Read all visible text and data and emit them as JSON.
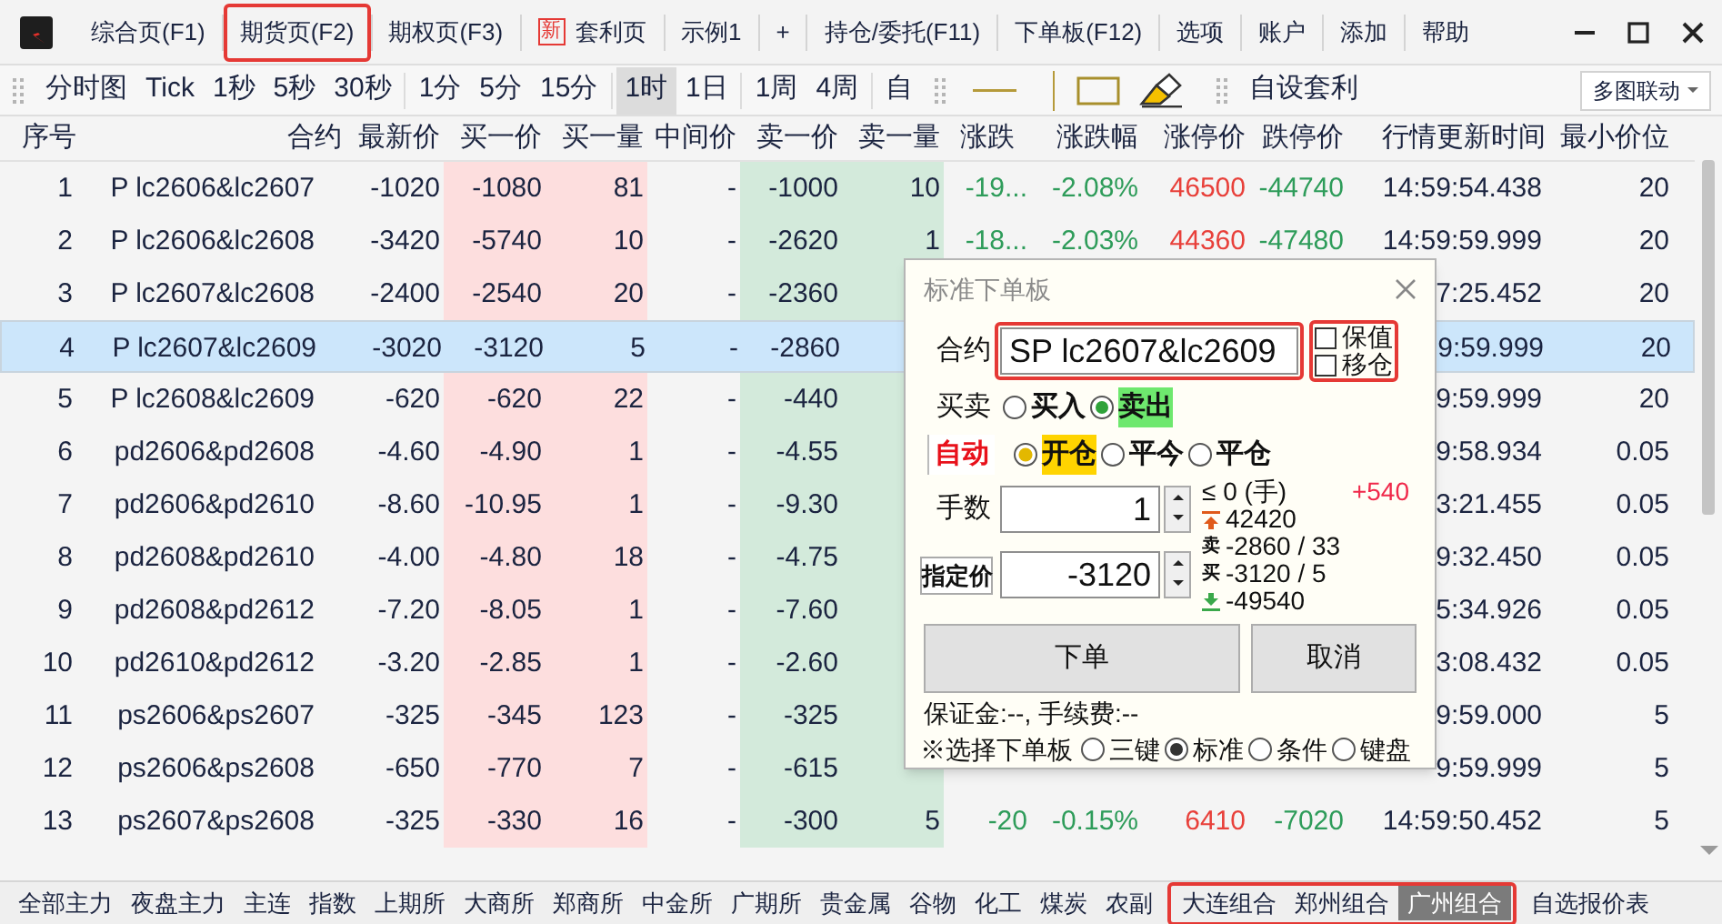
{
  "tabs": [
    {
      "label": "综合页(F1)",
      "highlighted": false
    },
    {
      "label": "期货页(F2)",
      "highlighted": true
    },
    {
      "label": "期权页(F3)",
      "highlighted": false
    },
    {
      "label": "套利页",
      "badge": "新",
      "highlighted": false
    },
    {
      "label": "示例1",
      "highlighted": false
    },
    {
      "label": "+",
      "highlighted": false
    },
    {
      "label": "持仓/委托(F11)",
      "highlighted": false
    },
    {
      "label": "下单板(F12)",
      "highlighted": false
    },
    {
      "label": "选项",
      "highlighted": false
    },
    {
      "label": "账户",
      "highlighted": false
    },
    {
      "label": "添加",
      "highlighted": false
    },
    {
      "label": "帮助",
      "highlighted": false
    }
  ],
  "period_groups": [
    [
      {
        "label": "分时图",
        "selected": false
      },
      {
        "label": "Tick",
        "selected": false
      },
      {
        "label": "1秒",
        "selected": false
      },
      {
        "label": "5秒",
        "selected": false
      },
      {
        "label": "30秒",
        "selected": false
      }
    ],
    [
      {
        "label": "1分",
        "selected": false
      },
      {
        "label": "5分",
        "selected": false
      },
      {
        "label": "15分",
        "selected": false
      }
    ],
    [
      {
        "label": "1时",
        "selected": true
      },
      {
        "label": "1日",
        "selected": false
      }
    ],
    [
      {
        "label": "1周",
        "selected": false
      },
      {
        "label": "4周",
        "selected": false
      }
    ],
    [
      {
        "label": "自",
        "selected": false
      }
    ]
  ],
  "custom_spread_button": "自设套利",
  "linked_charts_dropdown": "多图联动",
  "table": {
    "columns": [
      "序号",
      "合约",
      "最新价",
      "买一价",
      "买一量",
      "中间价",
      "卖一价",
      "卖一量",
      "涨跌",
      "涨跌幅",
      "涨停价",
      "跌停价",
      "行情更新时间",
      "最小价位"
    ],
    "rows": [
      {
        "selected": false,
        "cells": [
          "1",
          "P lc2606&lc2607",
          "-1020",
          "-1080",
          "81",
          "-",
          "-1000",
          "10",
          "-19...",
          "-2.08%",
          "46500",
          "-44740",
          "14:59:54.438",
          "20"
        ]
      },
      {
        "selected": false,
        "cells": [
          "2",
          "P lc2606&lc2608",
          "-3420",
          "-5740",
          "10",
          "-",
          "-2620",
          "1",
          "-18...",
          "-2.03%",
          "44360",
          "-47480",
          "14:59:59.999",
          "20"
        ]
      },
      {
        "selected": false,
        "cells": [
          "3",
          "P lc2607&lc2608",
          "-2400",
          "-2540",
          "20",
          "-",
          "-2360",
          null,
          null,
          null,
          null,
          null,
          "7:25.452",
          "20"
        ]
      },
      {
        "selected": true,
        "cells": [
          "4",
          "P lc2607&lc2609",
          "-3020",
          "-3120",
          "5",
          "-",
          "-2860",
          null,
          null,
          null,
          null,
          null,
          "9:59.999",
          "20"
        ]
      },
      {
        "selected": false,
        "cells": [
          "5",
          "P lc2608&lc2609",
          "-620",
          "-620",
          "22",
          "-",
          "-440",
          null,
          null,
          null,
          null,
          null,
          "9:59.999",
          "20"
        ]
      },
      {
        "selected": false,
        "cells": [
          "6",
          "pd2606&pd2608",
          "-4.60",
          "-4.90",
          "1",
          "-",
          "-4.55",
          null,
          null,
          null,
          null,
          null,
          "9:58.934",
          "0.05"
        ]
      },
      {
        "selected": false,
        "cells": [
          "7",
          "pd2606&pd2610",
          "-8.60",
          "-10.95",
          "1",
          "-",
          "-9.30",
          null,
          null,
          null,
          null,
          null,
          "3:21.455",
          "0.05"
        ]
      },
      {
        "selected": false,
        "cells": [
          "8",
          "pd2608&pd2610",
          "-4.00",
          "-4.80",
          "18",
          "-",
          "-4.75",
          null,
          null,
          null,
          null,
          null,
          "9:32.450",
          "0.05"
        ]
      },
      {
        "selected": false,
        "cells": [
          "9",
          "pd2608&pd2612",
          "-7.20",
          "-8.05",
          "1",
          "-",
          "-7.60",
          null,
          null,
          null,
          null,
          null,
          "5:34.926",
          "0.05"
        ]
      },
      {
        "selected": false,
        "cells": [
          "10",
          "pd2610&pd2612",
          "-3.20",
          "-2.85",
          "1",
          "-",
          "-2.60",
          null,
          null,
          null,
          null,
          null,
          "3:08.432",
          "0.05"
        ]
      },
      {
        "selected": false,
        "cells": [
          "11",
          "ps2606&ps2607",
          "-325",
          "-345",
          "123",
          "-",
          "-325",
          null,
          null,
          null,
          null,
          null,
          "9:59.000",
          "5"
        ]
      },
      {
        "selected": false,
        "cells": [
          "12",
          "ps2606&ps2608",
          "-650",
          "-770",
          "7",
          "-",
          "-615",
          null,
          null,
          null,
          null,
          null,
          "9:59.999",
          "5"
        ]
      },
      {
        "selected": false,
        "cells": [
          "13",
          "ps2607&ps2608",
          "-325",
          "-330",
          "16",
          "-",
          "-300",
          "5",
          "-20",
          "-0.15%",
          "6410",
          "-7020",
          "14:59:50.452",
          "5"
        ]
      }
    ]
  },
  "bottom_tab_groups": [
    {
      "highlighted": false,
      "tabs": [
        {
          "label": "全部主力",
          "selected": false
        },
        {
          "label": "夜盘主力",
          "selected": false
        },
        {
          "label": "主连",
          "selected": false
        },
        {
          "label": "指数",
          "selected": false
        },
        {
          "label": "上期所",
          "selected": false
        },
        {
          "label": "大商所",
          "selected": false
        },
        {
          "label": "郑商所",
          "selected": false
        },
        {
          "label": "中金所",
          "selected": false
        },
        {
          "label": "广期所",
          "selected": false
        },
        {
          "label": "贵金属",
          "selected": false
        },
        {
          "label": "谷物",
          "selected": false
        },
        {
          "label": "化工",
          "selected": false
        },
        {
          "label": "煤炭",
          "selected": false
        },
        {
          "label": "农副",
          "selected": false
        }
      ]
    },
    {
      "highlighted": true,
      "tabs": [
        {
          "label": "大连组合",
          "selected": false
        },
        {
          "label": "郑州组合",
          "selected": false
        },
        {
          "label": "广州组合",
          "selected": true
        }
      ]
    },
    {
      "highlighted": false,
      "tabs": [
        {
          "label": "自选报价表",
          "selected": false
        }
      ]
    }
  ],
  "order_panel": {
    "title": "标准下单板",
    "contract_label": "合约",
    "contract": "SP lc2607&lc2609",
    "contract_highlighted": true,
    "options_highlighted": true,
    "options": [
      {
        "label": "保值",
        "checked": false
      },
      {
        "label": "移仓",
        "checked": false
      }
    ],
    "side_label": "买卖",
    "sides": [
      {
        "label": "买入",
        "selected": false
      },
      {
        "label": "卖出",
        "selected": true
      }
    ],
    "auto_button": "自动",
    "offsets": [
      {
        "label": "开仓",
        "selected": true
      },
      {
        "label": "平今",
        "selected": false
      },
      {
        "label": "平仓",
        "selected": false
      }
    ],
    "qty_label": "手数",
    "qty": "1",
    "qty_limit": "≤ 0 (手)",
    "delta": "+540",
    "price_button": "指定价",
    "price": "-3120",
    "quotes": [
      {
        "kind": "limit_up",
        "text": "42420"
      },
      {
        "kind": "ask",
        "mark": "卖",
        "text": "-2860 / 33"
      },
      {
        "kind": "bid",
        "mark": "买",
        "text": "-3120 / 5"
      },
      {
        "kind": "limit_down",
        "text": "-49540"
      }
    ],
    "submit_button": "下单",
    "cancel_button": "取消",
    "fees": "保证金:--, 手续费:--",
    "panel_label": "※选择下单板",
    "panel_types": [
      {
        "label": "三键",
        "selected": false
      },
      {
        "label": "标准",
        "selected": true
      },
      {
        "label": "条件",
        "selected": false
      },
      {
        "label": "键盘",
        "selected": false
      }
    ]
  }
}
